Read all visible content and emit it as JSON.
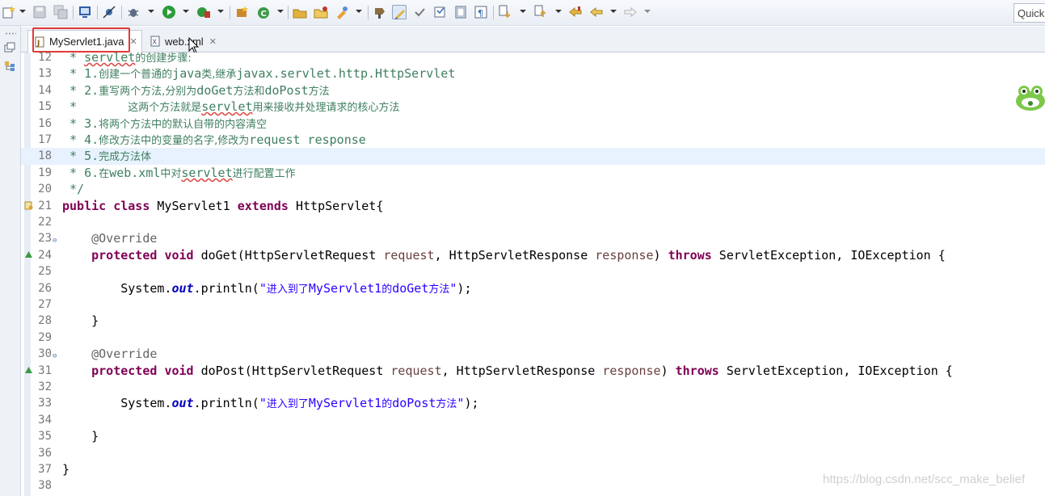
{
  "toolbar": {
    "buttons": [
      "new-icon",
      "save-icon",
      "save-all-icon",
      "publish-icon",
      "skip-breakpoints-icon",
      "debug-icon",
      "run-icon",
      "external-tools-icon",
      "new-java-package-icon",
      "new-java-class-icon",
      "open-type-icon",
      "open-task-icon",
      "search-icon",
      "toggle-mark-occurrences-icon",
      "toggle-block-selection-icon",
      "show-whitespace-icon",
      "next-annotation-icon",
      "previous-annotation-icon",
      "last-edit-location-icon",
      "back-icon",
      "forward-icon"
    ],
    "quick_access": "Quick"
  },
  "tabs": [
    {
      "label": "MyServlet1.java",
      "icon": "java-file-icon",
      "active": true
    },
    {
      "label": "web.xml",
      "icon": "xml-file-icon",
      "active": false
    }
  ],
  "colors": {
    "keyword": "#7f0055",
    "comment": "#3f7f5f",
    "string": "#2a00ff",
    "annotation": "#646464",
    "parameter": "#6a3e3e",
    "static_field": "#0000c0",
    "highlight_box": "#e23a3a",
    "current_line": "#e8f2fe"
  },
  "editor": {
    "current_line": 18,
    "lines": [
      {
        "n": "12",
        "segments": [
          {
            "t": " * ",
            "c": "cm"
          },
          {
            "t": "servlet",
            "c": "cm cm-sq"
          },
          {
            "t": "的创建步骤:",
            "c": "cm cjk"
          }
        ]
      },
      {
        "n": "13",
        "segments": [
          {
            "t": " * 1.",
            "c": "cm"
          },
          {
            "t": "创建一个普通的",
            "c": "cm cjk"
          },
          {
            "t": "java",
            "c": "cm"
          },
          {
            "t": "类,继承",
            "c": "cm cjk"
          },
          {
            "t": "javax.servlet.http.HttpServlet",
            "c": "cm"
          }
        ]
      },
      {
        "n": "14",
        "segments": [
          {
            "t": " * 2.",
            "c": "cm"
          },
          {
            "t": "重写两个方法,分别为",
            "c": "cm cjk"
          },
          {
            "t": "doGet",
            "c": "cm"
          },
          {
            "t": "方法和",
            "c": "cm cjk"
          },
          {
            "t": "doPost",
            "c": "cm"
          },
          {
            "t": "方法",
            "c": "cm cjk"
          }
        ]
      },
      {
        "n": "15",
        "segments": [
          {
            "t": " *       ",
            "c": "cm"
          },
          {
            "t": "这两个方法就是",
            "c": "cm cjk"
          },
          {
            "t": "servlet",
            "c": "cm cm-sq"
          },
          {
            "t": "用来接收并处理请求的核心方法",
            "c": "cm cjk"
          }
        ]
      },
      {
        "n": "16",
        "segments": [
          {
            "t": " * 3.",
            "c": "cm"
          },
          {
            "t": "将两个方法中的默认自带的内容清空",
            "c": "cm cjk"
          }
        ]
      },
      {
        "n": "17",
        "segments": [
          {
            "t": " * 4.",
            "c": "cm"
          },
          {
            "t": "修改方法中的变量的名字,修改为",
            "c": "cm cjk"
          },
          {
            "t": "request response",
            "c": "cm"
          }
        ]
      },
      {
        "n": "18",
        "segments": [
          {
            "t": " * 5.",
            "c": "cm"
          },
          {
            "t": "完成方法体",
            "c": "cm cjk"
          }
        ]
      },
      {
        "n": "19",
        "segments": [
          {
            "t": " * 6.",
            "c": "cm"
          },
          {
            "t": "在",
            "c": "cm cjk"
          },
          {
            "t": "web.xml",
            "c": "cm"
          },
          {
            "t": "中对",
            "c": "cm cjk"
          },
          {
            "t": "servlet",
            "c": "cm cm-sq"
          },
          {
            "t": "进行配置工作",
            "c": "cm cjk"
          }
        ]
      },
      {
        "n": "20",
        "segments": [
          {
            "t": " */",
            "c": "cm"
          }
        ]
      },
      {
        "n": "21",
        "marker": "warning",
        "segments": [
          {
            "t": "public",
            "c": "kw"
          },
          {
            "t": " ",
            "c": "plain"
          },
          {
            "t": "class",
            "c": "kw"
          },
          {
            "t": " MyServlet1 ",
            "c": "plain"
          },
          {
            "t": "extends",
            "c": "kw"
          },
          {
            "t": " HttpServlet{",
            "c": "plain"
          }
        ]
      },
      {
        "n": "22",
        "segments": []
      },
      {
        "n": "23",
        "fold": true,
        "segments": [
          {
            "t": "    @Override",
            "c": "ann"
          }
        ]
      },
      {
        "n": "24",
        "marker": "override",
        "segments": [
          {
            "t": "    ",
            "c": "plain"
          },
          {
            "t": "protected",
            "c": "kw"
          },
          {
            "t": " ",
            "c": "plain"
          },
          {
            "t": "void",
            "c": "kw"
          },
          {
            "t": " doGet(HttpServletRequest ",
            "c": "plain"
          },
          {
            "t": "request",
            "c": "param"
          },
          {
            "t": ", HttpServletResponse ",
            "c": "plain"
          },
          {
            "t": "response",
            "c": "param"
          },
          {
            "t": ") ",
            "c": "plain"
          },
          {
            "t": "throws",
            "c": "kw"
          },
          {
            "t": " ServletException, IOException {",
            "c": "plain"
          }
        ]
      },
      {
        "n": "25",
        "segments": []
      },
      {
        "n": "26",
        "segments": [
          {
            "t": "        System.",
            "c": "plain"
          },
          {
            "t": "out",
            "c": "field"
          },
          {
            "t": ".println(",
            "c": "plain"
          },
          {
            "t": "\"",
            "c": "str"
          },
          {
            "t": "进入到了",
            "c": "str cjk"
          },
          {
            "t": "MyServlet1",
            "c": "str"
          },
          {
            "t": "的",
            "c": "str cjk"
          },
          {
            "t": "doGet",
            "c": "str"
          },
          {
            "t": "方法",
            "c": "str cjk"
          },
          {
            "t": "\"",
            "c": "str"
          },
          {
            "t": ");",
            "c": "plain"
          }
        ]
      },
      {
        "n": "27",
        "segments": []
      },
      {
        "n": "28",
        "segments": [
          {
            "t": "    }",
            "c": "plain"
          }
        ]
      },
      {
        "n": "29",
        "segments": []
      },
      {
        "n": "30",
        "fold": true,
        "segments": [
          {
            "t": "    @Override",
            "c": "ann"
          }
        ]
      },
      {
        "n": "31",
        "marker": "override",
        "segments": [
          {
            "t": "    ",
            "c": "plain"
          },
          {
            "t": "protected",
            "c": "kw"
          },
          {
            "t": " ",
            "c": "plain"
          },
          {
            "t": "void",
            "c": "kw"
          },
          {
            "t": " doPost(HttpServletRequest ",
            "c": "plain"
          },
          {
            "t": "request",
            "c": "param"
          },
          {
            "t": ", HttpServletResponse ",
            "c": "plain"
          },
          {
            "t": "response",
            "c": "param"
          },
          {
            "t": ") ",
            "c": "plain"
          },
          {
            "t": "throws",
            "c": "kw"
          },
          {
            "t": " ServletException, IOException {",
            "c": "plain"
          }
        ]
      },
      {
        "n": "32",
        "segments": []
      },
      {
        "n": "33",
        "segments": [
          {
            "t": "        System.",
            "c": "plain"
          },
          {
            "t": "out",
            "c": "field"
          },
          {
            "t": ".println(",
            "c": "plain"
          },
          {
            "t": "\"",
            "c": "str"
          },
          {
            "t": "进入到了",
            "c": "str cjk"
          },
          {
            "t": "MyServlet1",
            "c": "str"
          },
          {
            "t": "的",
            "c": "str cjk"
          },
          {
            "t": "doPost",
            "c": "str"
          },
          {
            "t": "方法",
            "c": "str cjk"
          },
          {
            "t": "\"",
            "c": "str"
          },
          {
            "t": ");",
            "c": "plain"
          }
        ]
      },
      {
        "n": "34",
        "segments": []
      },
      {
        "n": "35",
        "segments": [
          {
            "t": "    }",
            "c": "plain"
          }
        ]
      },
      {
        "n": "36",
        "segments": []
      },
      {
        "n": "37",
        "segments": [
          {
            "t": "}",
            "c": "plain"
          }
        ]
      },
      {
        "n": "38",
        "segments": []
      }
    ]
  },
  "watermark": "https://blog.csdn.net/scc_make_belief"
}
